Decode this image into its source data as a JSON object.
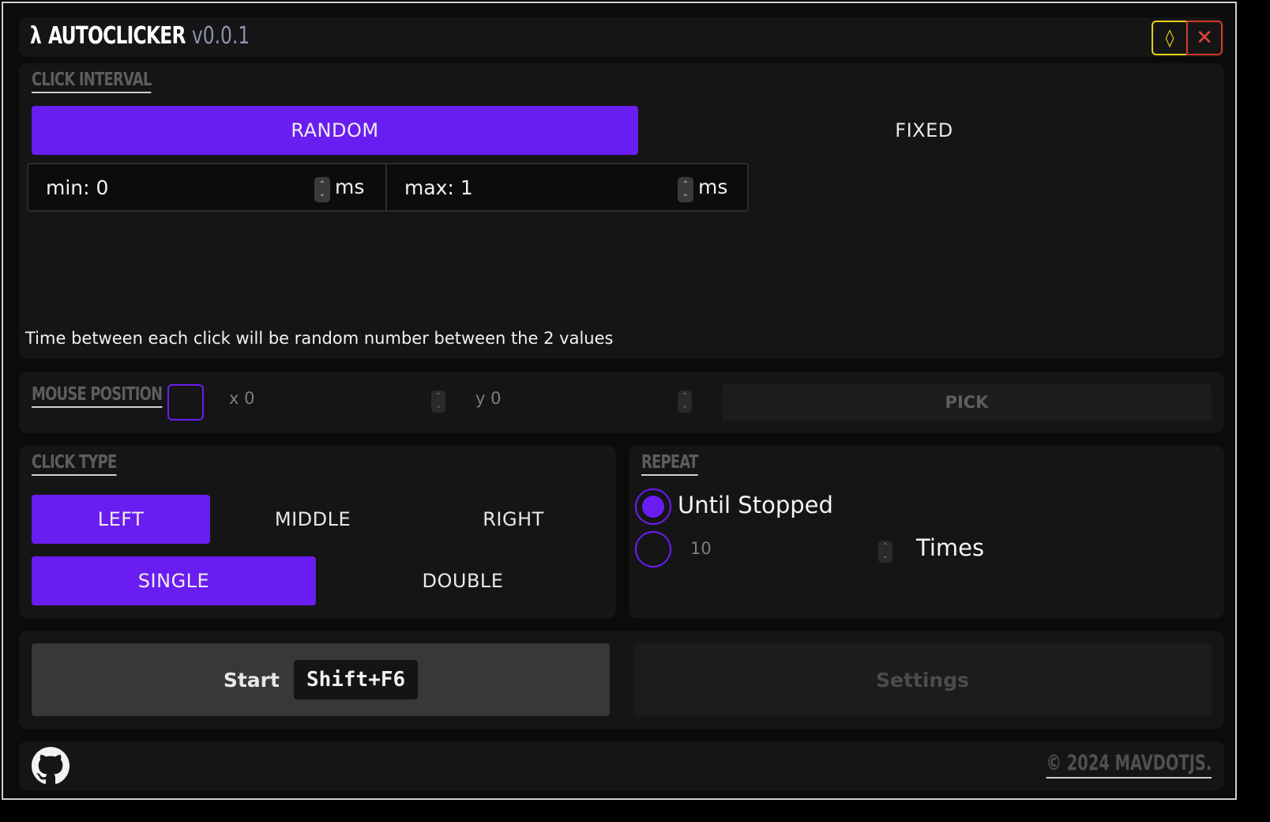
{
  "titlebar": {
    "logo": "λ",
    "app_name": "AUTOCLICKER",
    "version": "v0.0.1",
    "pin_icon": "diamond-icon",
    "close_icon": "close-icon"
  },
  "interval": {
    "heading": "CLICK INTERVAL",
    "modes": [
      {
        "label": "RANDOM",
        "active": true
      },
      {
        "label": "FIXED",
        "active": false
      }
    ],
    "min_value": "min: 0",
    "min_unit": "ms",
    "max_value": "max: 1",
    "max_unit": "ms",
    "description": "Time between each click will be random number between the 2 values"
  },
  "mouse_position": {
    "heading": "MOUSE POSITION",
    "enabled": false,
    "x_value": "x 0",
    "y_value": "y 0",
    "pick_label": "PICK"
  },
  "click_type": {
    "heading": "CLICK TYPE",
    "buttons": [
      {
        "label": "LEFT",
        "active": true
      },
      {
        "label": "MIDDLE",
        "active": false
      },
      {
        "label": "RIGHT",
        "active": false
      }
    ],
    "modes": [
      {
        "label": "SINGLE",
        "active": true
      },
      {
        "label": "DOUBLE",
        "active": false
      }
    ]
  },
  "repeat": {
    "heading": "REPEAT",
    "until_stopped_label": "Until Stopped",
    "until_stopped_selected": true,
    "times_value": "10",
    "times_label": "Times",
    "times_selected": false
  },
  "actions": {
    "start_label": "Start",
    "start_hotkey": "Shift+F6",
    "settings_label": "Settings"
  },
  "footer": {
    "github_icon": "github-icon",
    "copyright": "© 2024 MAVDOTJS."
  },
  "colors": {
    "accent": "#6a1df0",
    "pin": "#e6d11c",
    "close": "#d23a2a",
    "background": "#0b0b0b",
    "panel": "#151515"
  }
}
